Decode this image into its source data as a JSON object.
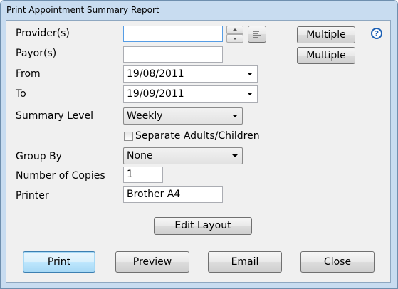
{
  "window": {
    "title": "Print Appointment Summary Report"
  },
  "labels": {
    "providers": "Provider(s)",
    "payors": "Payor(s)",
    "from": "From",
    "to": "To",
    "summary_level": "Summary Level",
    "group_by": "Group By",
    "copies": "Number of Copies",
    "printer": "Printer"
  },
  "fields": {
    "providers_value": "",
    "payors_value": "",
    "from_date": "19/08/2011",
    "to_date": "19/09/2011",
    "summary_level": "Weekly",
    "group_by": "None",
    "copies": "1",
    "printer": "Brother A4"
  },
  "checkbox": {
    "separate_label": "Separate Adults/Children",
    "checked": false
  },
  "buttons": {
    "multiple_providers": "Multiple",
    "multiple_payors": "Multiple",
    "edit_layout": "Edit Layout",
    "print": "Print",
    "preview": "Preview",
    "email": "Email",
    "close": "Close"
  },
  "icons": {
    "help": "?"
  }
}
